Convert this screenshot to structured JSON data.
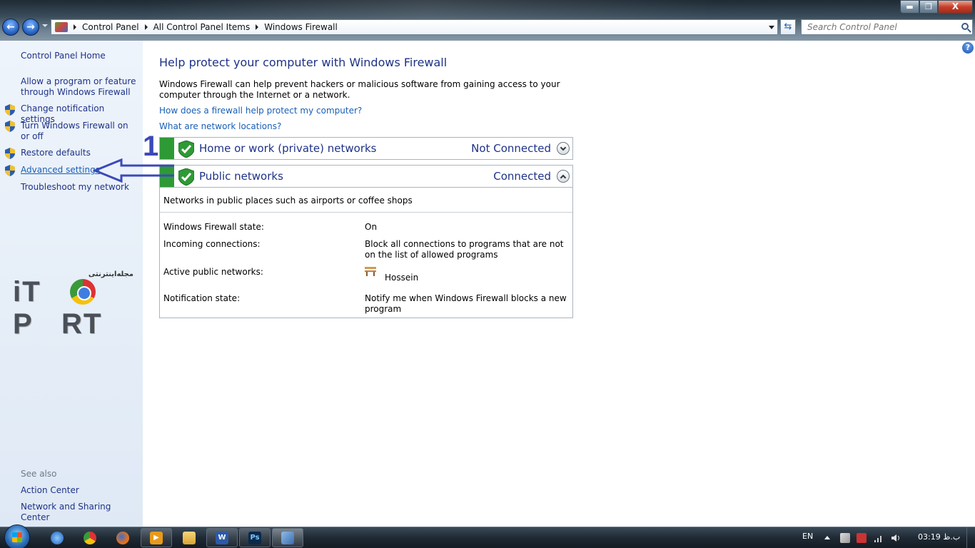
{
  "address_bar": {
    "breadcrumbs": [
      "Control Panel",
      "All Control Panel Items",
      "Windows Firewall"
    ],
    "search_placeholder": "Search Control Panel"
  },
  "window_controls": {
    "minimize": "▬",
    "maximize": "❐",
    "close": "X"
  },
  "left_pane": {
    "home": "Control Panel Home",
    "items": [
      "Allow a program or feature through Windows Firewall",
      "Change notification settings",
      "Turn Windows Firewall on or off",
      "Restore defaults",
      "Advanced settings",
      "Troubleshoot my network"
    ],
    "see_also_heading": "See also",
    "see_also": [
      "Action Center",
      "Network and Sharing Center"
    ]
  },
  "logo": {
    "text": "iT PORT",
    "subtitle": "مجله اینترنتی"
  },
  "main": {
    "title": "Help protect your computer with Windows Firewall",
    "intro": "Windows Firewall can help prevent hackers or malicious software from gaining access to your computer through the Internet or a network.",
    "links": [
      "How does a firewall help protect my computer?",
      "What are network locations?"
    ],
    "networks": [
      {
        "name": "Home or work (private) networks",
        "status": "Not Connected",
        "expanded": false
      },
      {
        "name": "Public networks",
        "status": "Connected",
        "expanded": true
      }
    ],
    "public_details": {
      "description": "Networks in public places such as airports or coffee shops",
      "rows": [
        {
          "label": "Windows Firewall state:",
          "value": "On"
        },
        {
          "label": "Incoming connections:",
          "value": "Block all connections to programs that are not on the list of allowed programs"
        },
        {
          "label": "Active public networks:",
          "value": "Hossein"
        },
        {
          "label": "Notification state:",
          "value": "Notify me when Windows Firewall blocks a new program"
        }
      ]
    }
  },
  "annotation": {
    "number": "1"
  },
  "taskbar": {
    "apps": [
      "ie-icon",
      "chrome-icon",
      "firefox-icon",
      "media-player-icon",
      "explorer-icon",
      "word-icon",
      "photoshop-icon",
      "control-panel-icon"
    ],
    "word_label": "W",
    "photoshop_label": "Ps",
    "language": "EN",
    "clock": "03:19 ب.ظ"
  },
  "colors": {
    "link": "#1a5fb4",
    "heading": "#1e3287",
    "firewall_green": "#2e9a35",
    "annotation": "#3b49b8"
  }
}
